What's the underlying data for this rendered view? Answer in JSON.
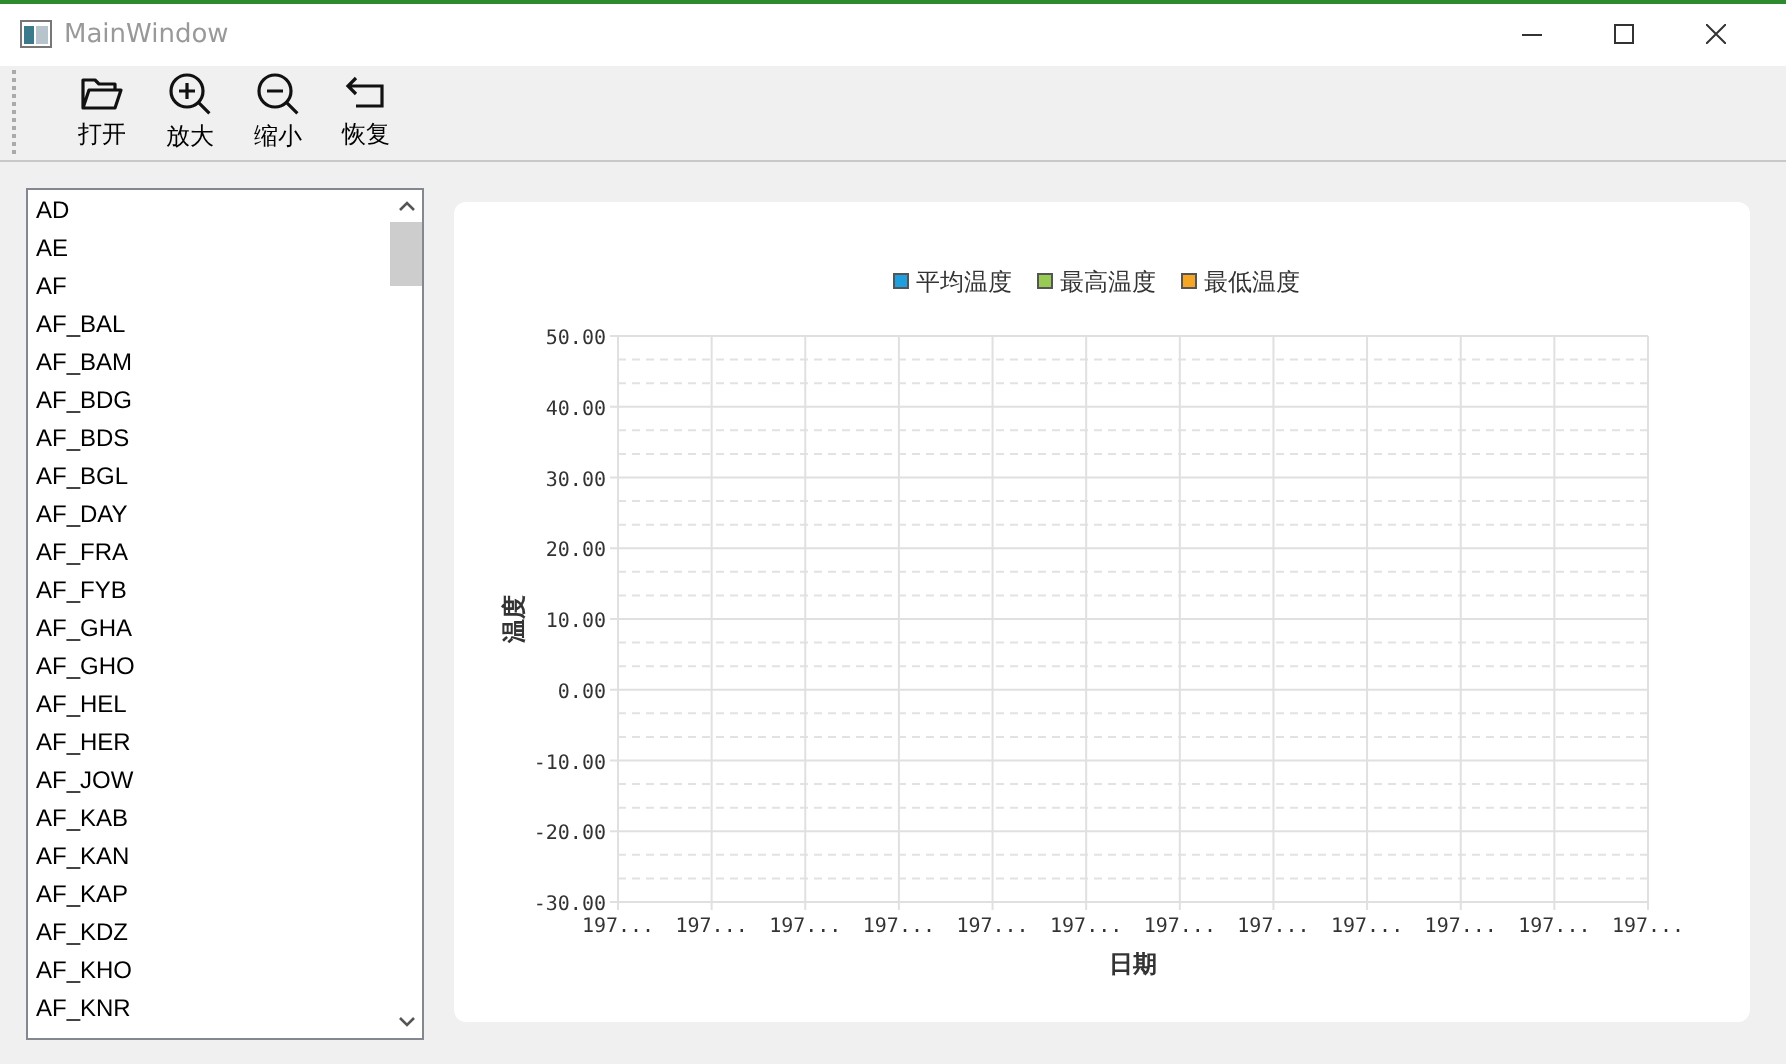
{
  "window": {
    "title": "MainWindow"
  },
  "toolbar": [
    {
      "label": "打开",
      "kind": "open"
    },
    {
      "label": "放大",
      "kind": "zoom_in"
    },
    {
      "label": "缩小",
      "kind": "zoom_out"
    },
    {
      "label": "恢复",
      "kind": "restore"
    }
  ],
  "list": {
    "items": [
      {
        "label": "AD",
        "selected": false
      },
      {
        "label": "AE",
        "selected": false
      },
      {
        "label": "AF",
        "selected": false
      },
      {
        "label": "AF_BAL",
        "selected": false
      },
      {
        "label": "AF_BAM",
        "selected": false
      },
      {
        "label": "AF_BDG",
        "selected": false
      },
      {
        "label": "AF_BDS",
        "selected": false
      },
      {
        "label": "AF_BGL",
        "selected": false
      },
      {
        "label": "AF_DAY",
        "selected": false
      },
      {
        "label": "AF_FRA",
        "selected": false
      },
      {
        "label": "AF_FYB",
        "selected": false
      },
      {
        "label": "AF_GHA",
        "selected": false
      },
      {
        "label": "AF_GHO",
        "selected": false
      },
      {
        "label": "AF_HEL",
        "selected": false
      },
      {
        "label": "AF_HER",
        "selected": false
      },
      {
        "label": "AF_JOW",
        "selected": false
      },
      {
        "label": "AF_KAB",
        "selected": false
      },
      {
        "label": "AF_KAN",
        "selected": false
      },
      {
        "label": "AF_KAP",
        "selected": false
      },
      {
        "label": "AF_KDZ",
        "selected": false
      },
      {
        "label": "AF_KHO",
        "selected": false
      },
      {
        "label": "AF_KNR",
        "selected": false
      }
    ]
  },
  "chart": {
    "chart_data": {
      "type": "line",
      "xlabel": "日期",
      "ylabel": "温度",
      "categories": [
        "197...",
        "197...",
        "197...",
        "197...",
        "197...",
        "197...",
        "197...",
        "197...",
        "197...",
        "197...",
        "197...",
        "197..."
      ],
      "series": [
        {
          "name": "平均温度",
          "color": "#209fdf",
          "values": [
            null,
            null,
            null,
            null,
            null,
            null,
            null,
            null,
            null,
            null,
            null,
            null
          ]
        },
        {
          "name": "最高温度",
          "color": "#99ca53",
          "values": [
            null,
            null,
            null,
            null,
            null,
            null,
            null,
            null,
            null,
            null,
            null,
            null
          ]
        },
        {
          "name": "最低温度",
          "color": "#f6a625",
          "values": [
            null,
            null,
            null,
            null,
            null,
            null,
            null,
            null,
            null,
            null,
            null,
            null
          ]
        }
      ],
      "ylim": [
        -30,
        50
      ],
      "grid": true,
      "yticks": [
        {
          "value": -30,
          "label": "-30.00"
        },
        {
          "value": -20,
          "label": "-20.00"
        },
        {
          "value": -10,
          "label": "-10.00"
        },
        {
          "value": 0,
          "label": "0.00"
        },
        {
          "value": 10,
          "label": "10.00"
        },
        {
          "value": 20,
          "label": "20.00"
        },
        {
          "value": 30,
          "label": "30.00"
        },
        {
          "value": 40,
          "label": "40.00"
        },
        {
          "value": 50,
          "label": "50.00"
        }
      ]
    }
  }
}
